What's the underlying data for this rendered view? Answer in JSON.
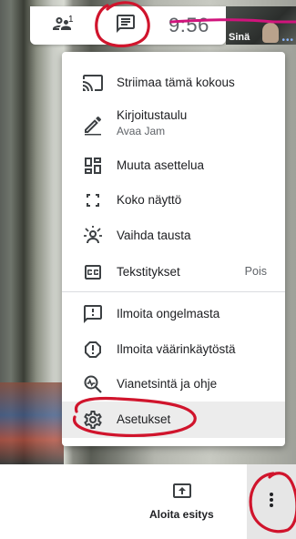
{
  "topbar": {
    "participants_badge": "1",
    "time": "9:56"
  },
  "self_view": {
    "label": "Sinä",
    "dots": "•••"
  },
  "menu": {
    "items": [
      {
        "label": "Striimaa tämä kokous",
        "icon": "cast-icon"
      },
      {
        "label": "Kirjoitustaulu",
        "sub": "Avaa Jam",
        "icon": "pen-icon"
      },
      {
        "label": "Muuta asettelua",
        "icon": "layout-icon"
      },
      {
        "label": "Koko näyttö",
        "icon": "fullscreen-icon"
      },
      {
        "label": "Vaihda tausta",
        "icon": "background-icon"
      },
      {
        "label": "Tekstitykset",
        "value": "Pois",
        "icon": "captions-icon"
      },
      {
        "label": "Ilmoita ongelmasta",
        "icon": "feedback-icon"
      },
      {
        "label": "Ilmoita väärinkäytöstä",
        "icon": "report-icon"
      },
      {
        "label": "Vianetsintä ja ohje",
        "icon": "troubleshoot-icon"
      },
      {
        "label": "Asetukset",
        "icon": "settings-icon"
      }
    ]
  },
  "bottombar": {
    "present_label": "Aloita esitys"
  },
  "colors": {
    "annotation": "#d0142c",
    "magenta_line": "#d0147c",
    "icon": "#3c4043"
  }
}
